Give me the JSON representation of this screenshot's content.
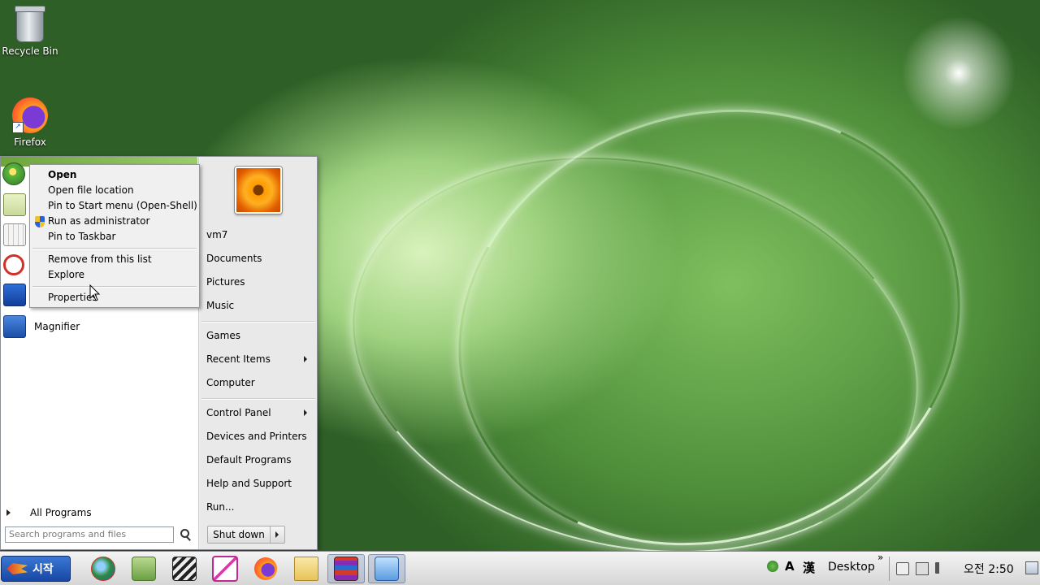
{
  "desktop": {
    "icons": [
      {
        "label": "Recycle Bin",
        "icon": "recycle-bin-icon"
      },
      {
        "label": "Firefox",
        "icon": "firefox-icon"
      }
    ]
  },
  "start_menu": {
    "pinned_programs": [
      {
        "label": "",
        "icon": "start-orb-icon"
      },
      {
        "label": "",
        "icon": "notepad-icon"
      },
      {
        "label": "",
        "icon": "calculator-icon"
      },
      {
        "label": "",
        "icon": "snipping-tool-icon"
      },
      {
        "label": "",
        "icon": "remote-desktop-icon"
      },
      {
        "label": "Magnifier",
        "icon": "magnifier-icon"
      }
    ],
    "all_programs": "All Programs",
    "search_placeholder": "Search programs and files",
    "right": {
      "user": "vm7",
      "documents": "Documents",
      "pictures": "Pictures",
      "music": "Music",
      "games": "Games",
      "recent_items": "Recent Items",
      "computer": "Computer",
      "control_panel": "Control Panel",
      "devices_printers": "Devices and Printers",
      "default_programs": "Default Programs",
      "help_support": "Help and Support",
      "run": "Run..."
    },
    "shutdown": "Shut down"
  },
  "context_menu": {
    "items": [
      "Open",
      "Open file location",
      "Pin to Start menu (Open-Shell)",
      "Run as administrator",
      "Pin to Taskbar",
      "Remove from this list",
      "Explore",
      "Properties"
    ]
  },
  "taskbar": {
    "start_label": "시작",
    "apps": [
      "browser-globe-icon",
      "notes-icon",
      "clapperboard-icon",
      "paint-icon",
      "firefox-icon",
      "folder-icon",
      "winrar-icon",
      "control-panel-icon"
    ],
    "ime_letter": "A",
    "ime_hanja": "漢",
    "desktop_toolbar": "Desktop",
    "clock": "오전 2:50"
  }
}
